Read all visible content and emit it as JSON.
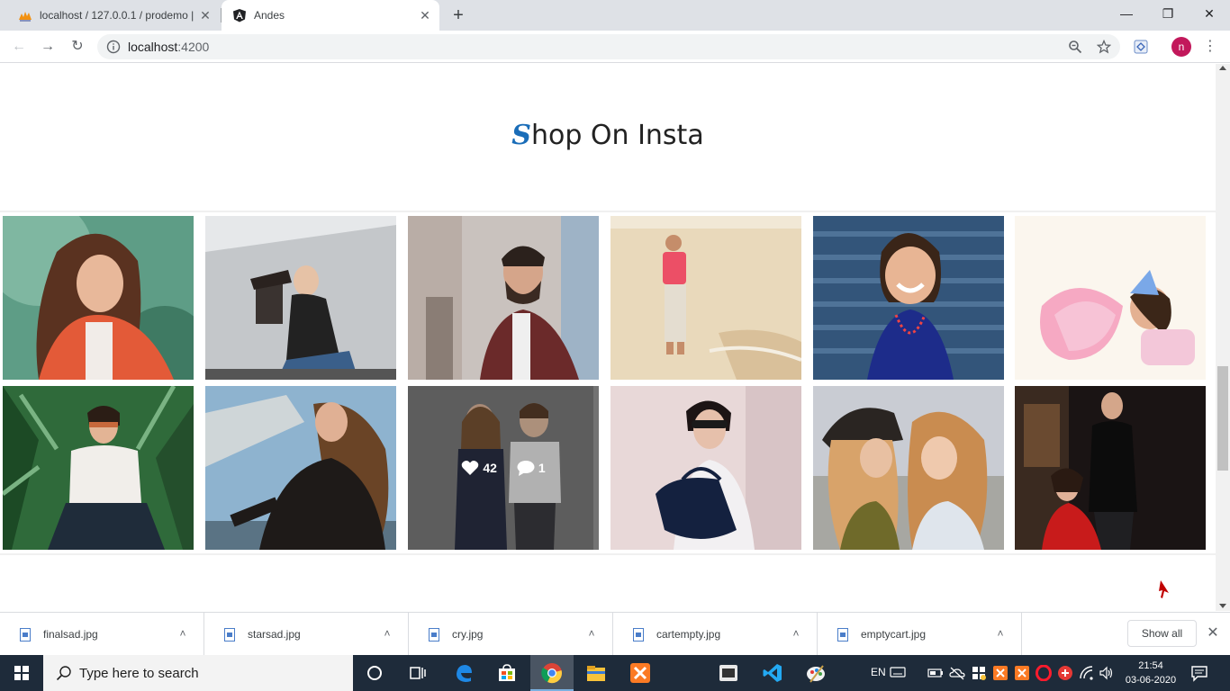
{
  "browser": {
    "tabs": [
      {
        "title": "localhost / 127.0.0.1 / prodemo |",
        "icon": "phpmyadmin-icon"
      },
      {
        "title": "Andes",
        "icon": "angular-icon",
        "active": true
      }
    ],
    "new_tab_label": "+",
    "address": {
      "host": "localhost",
      "port": ":4200"
    },
    "profile_initial": "n"
  },
  "page": {
    "title_first_letter": "S",
    "title_rest": "hop On Insta",
    "gallery": [
      {
        "photo": "woman-orange-jacket"
      },
      {
        "photo": "woman-sitting-wall"
      },
      {
        "photo": "man-burgundy-jacket"
      },
      {
        "photo": "man-beach-walk"
      },
      {
        "photo": "girl-blue-dress"
      },
      {
        "photo": "girl-pink-tutu"
      },
      {
        "photo": "woman-current-mood-shirt"
      },
      {
        "photo": "woman-leather-jacket"
      },
      {
        "photo": "kids-pair",
        "likes": "42",
        "comments": "1"
      },
      {
        "photo": "woman-handbag"
      },
      {
        "photo": "two-women-laughing"
      },
      {
        "photo": "couple-dark"
      }
    ]
  },
  "downloads": {
    "items": [
      "finalsad.jpg",
      "starsad.jpg",
      "cry.jpg",
      "cartempty.jpg",
      "emptycart.jpg"
    ],
    "show_all_label": "Show all"
  },
  "taskbar": {
    "search_placeholder": "Type here to search",
    "language": "EN",
    "time": "21:54",
    "date": "03-06-2020"
  }
}
